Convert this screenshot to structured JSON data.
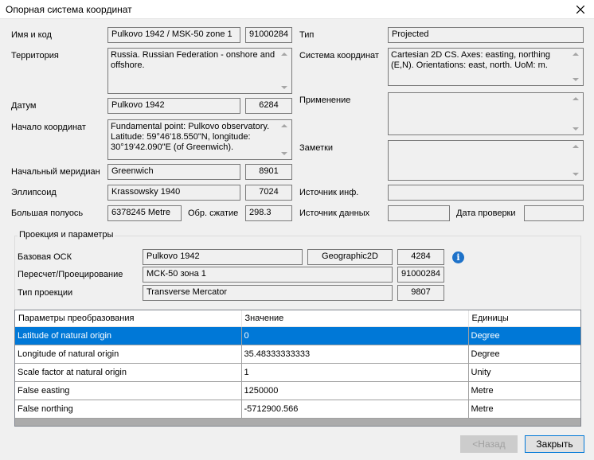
{
  "window": {
    "title": "Опорная система координат"
  },
  "left": {
    "name_label": "Имя и код",
    "name_value": "Pulkovo 1942 / MSK-50 zone 1",
    "name_code": "91000284",
    "territory_label": "Территория",
    "territory_value": "Russia. Russian Federation - onshore and offshore.",
    "datum_label": "Датум",
    "datum_value": "Pulkovo 1942",
    "datum_code": "6284",
    "origin_label": "Начало координат",
    "origin_value": "Fundamental point: Pulkovo observatory. Latitude: 59°46'18.550\"N, longitude: 30°19'42.090\"E (of Greenwich).",
    "meridian_label": "Начальный меридиан",
    "meridian_value": "Greenwich",
    "meridian_code": "8901",
    "ellipsoid_label": "Эллипсоид",
    "ellipsoid_value": "Krassowsky 1940",
    "ellipsoid_code": "7024",
    "semimajor_label": "Большая полуось",
    "semimajor_value": "6378245 Metre",
    "flattening_label": "Обр. сжатие",
    "flattening_value": "298.3"
  },
  "right": {
    "type_label": "Тип",
    "type_value": "Projected",
    "cs_label": "Система координат",
    "cs_value": "Cartesian 2D CS. Axes: easting, northing (E,N). Orientations: east, north. UoM: m.",
    "usage_label": "Применение",
    "usage_value": "",
    "notes_label": "Заметки",
    "notes_value": "",
    "info_source_label": "Источник инф.",
    "info_source_value": "",
    "data_source_label": "Источник данных",
    "data_source_value": "",
    "check_date_label": "Дата проверки",
    "check_date_value": ""
  },
  "projection": {
    "group_label": "Проекция и параметры",
    "base_label": "Базовая ОСК",
    "base_value": "Pulkovo 1942",
    "base_type": "Geographic2D",
    "base_code": "4284",
    "conversion_label": "Пересчет/Проецирование",
    "conversion_value": "МСК-50 зона 1",
    "conversion_code": "91000284",
    "method_label": "Тип проекции",
    "method_value": "Transverse Mercator",
    "method_code": "9807",
    "info_icon": "info-icon"
  },
  "params": {
    "headers": {
      "param": "Параметры преобразования",
      "value": "Значение",
      "units": "Единицы"
    },
    "rows": [
      {
        "param": "Latitude of natural origin",
        "value": "0",
        "units": "Degree",
        "selected": true
      },
      {
        "param": "Longitude of natural origin",
        "value": "35.48333333333",
        "units": "Degree"
      },
      {
        "param": "Scale factor at natural origin",
        "value": "1",
        "units": "Unity"
      },
      {
        "param": "False easting",
        "value": "1250000",
        "units": "Metre"
      },
      {
        "param": "False northing",
        "value": "-5712900.566",
        "units": "Metre"
      }
    ]
  },
  "buttons": {
    "back": "<Назад",
    "close": "Закрыть"
  },
  "colors": {
    "selection": "#0078d7",
    "accent_border": "#0078d7",
    "info_icon": "#1e72c9"
  }
}
